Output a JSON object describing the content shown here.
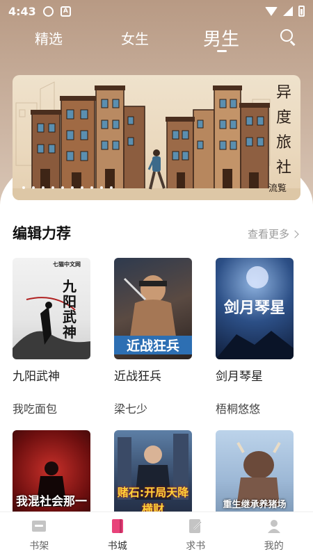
{
  "status_bar": {
    "time": "4:43",
    "icon2": "A"
  },
  "top_tabs": [
    {
      "label": "精选",
      "active": false
    },
    {
      "label": "女生",
      "active": false
    },
    {
      "label": "男生",
      "active": true
    }
  ],
  "banner": {
    "title": "异度旅社",
    "subtitle": "流覧"
  },
  "section": {
    "title": "编辑力荐",
    "more": "查看更多"
  },
  "books": [
    {
      "title": "九阳武神",
      "author": "我吃面包",
      "cover_text": "九阳武神",
      "cover_brand": "七猫中文网"
    },
    {
      "title": "近战狂兵",
      "author": "梁七少",
      "cover_text": "近战狂兵"
    },
    {
      "title": "剑月琴星",
      "author": "梧桐悠悠",
      "cover_text": "剑月琴星"
    },
    {
      "title": "",
      "author": "",
      "cover_text": "我混社会那一些年"
    },
    {
      "title": "",
      "author": "",
      "cover_text": "赌石:开局天降横财"
    },
    {
      "title": "",
      "author": "",
      "cover_text": "重生继承养猪场"
    }
  ],
  "bottom_nav": [
    {
      "label": "书架",
      "icon": "bookshelf-icon"
    },
    {
      "label": "书城",
      "icon": "bookstore-icon",
      "active": true
    },
    {
      "label": "求书",
      "icon": "request-book-icon"
    },
    {
      "label": "我的",
      "icon": "profile-icon"
    }
  ],
  "colors": {
    "accent": "#e8437a",
    "header": "#b89a84"
  }
}
